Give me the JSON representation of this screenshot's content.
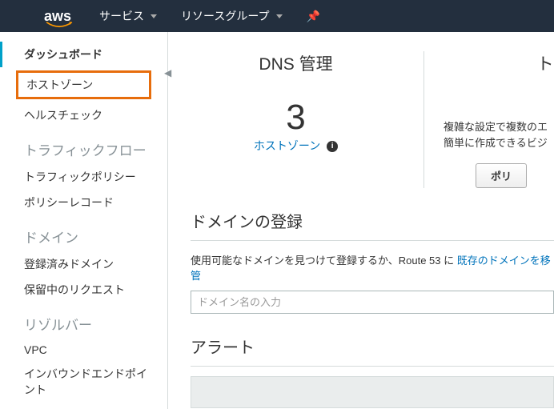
{
  "topbar": {
    "logo": "aws",
    "services": "サービス",
    "resource_groups": "リソースグループ"
  },
  "sidebar": {
    "items": [
      {
        "label": "ダッシュボード"
      },
      {
        "label": "ホストゾーン"
      },
      {
        "label": "ヘルスチェック"
      }
    ],
    "traffic_heading": "トラフィックフロー",
    "traffic_items": [
      {
        "label": "トラフィックポリシー"
      },
      {
        "label": "ポリシーレコード"
      }
    ],
    "domain_heading": "ドメイン",
    "domain_items": [
      {
        "label": "登録済みドメイン"
      },
      {
        "label": "保留中のリクエスト"
      }
    ],
    "resolver_heading": "リゾルバー",
    "resolver_items": [
      {
        "label": "VPC"
      },
      {
        "label": "インバウンドエンドポイント"
      }
    ]
  },
  "main": {
    "dns_title": "DNS 管理",
    "count": "3",
    "count_label": "ホストゾーン",
    "traffic_title": "トラフ",
    "traffic_desc1": "複雑な設定で複数のエ",
    "traffic_desc2": "簡単に作成できるビジ",
    "traffic_btn": "ポリ",
    "domain_reg_title": "ドメインの登録",
    "domain_reg_text": "使用可能なドメインを見つけて登録するか、Route 53 に ",
    "domain_reg_link": "既存のドメインを移管",
    "domain_placeholder": "ドメイン名の入力",
    "alert_title": "アラート"
  }
}
